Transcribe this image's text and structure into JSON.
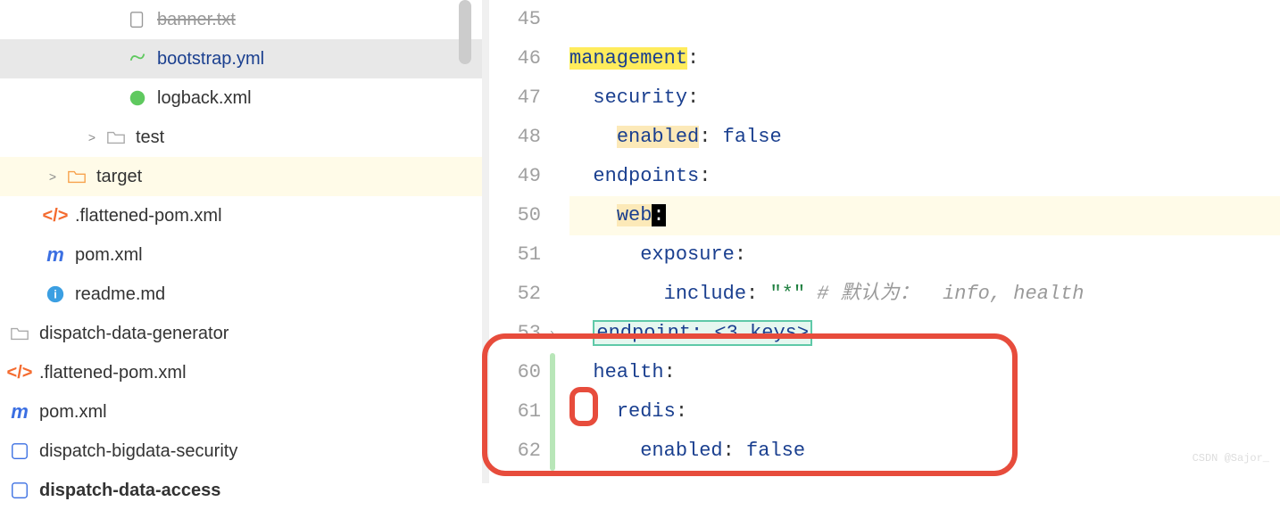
{
  "sidebar": {
    "items": [
      {
        "label": "banner.txt",
        "iconColor": "#888",
        "depth": 3,
        "selected": false,
        "bold": false,
        "expander": ""
      },
      {
        "label": "bootstrap.yml",
        "iconColor": "#5fc95f",
        "depth": 3,
        "selected": true,
        "bold": false,
        "expander": ""
      },
      {
        "label": "logback.xml",
        "iconColor": "#5fc95f",
        "depth": 3,
        "selected": false,
        "bold": false,
        "expander": ""
      },
      {
        "label": "test",
        "iconColor": "#bbb",
        "depth": 2,
        "selected": false,
        "bold": false,
        "expander": ">"
      },
      {
        "label": "target",
        "iconColor": "#f7a24c",
        "depth": 1,
        "selected": false,
        "bold": false,
        "expander": ">",
        "hl": true
      },
      {
        "label": ".flattened-pom.xml",
        "iconColor": "#f46b2f",
        "depth": 1,
        "selected": false,
        "bold": false,
        "expander": ""
      },
      {
        "label": "pom.xml",
        "iconColor": "#3b6fe2",
        "depth": 1,
        "selected": false,
        "bold": false,
        "expander": ""
      },
      {
        "label": "readme.md",
        "iconColor": "#3b9fe2",
        "depth": 1,
        "selected": false,
        "bold": false,
        "expander": ""
      },
      {
        "label": "dispatch-data-generator",
        "iconColor": "#bbb",
        "depth": 0,
        "selected": false,
        "bold": false,
        "expander": ""
      },
      {
        "label": ".flattened-pom.xml",
        "iconColor": "#f46b2f",
        "depth": 0,
        "selected": false,
        "bold": false,
        "expander": ""
      },
      {
        "label": "pom.xml",
        "iconColor": "#3b6fe2",
        "depth": 0,
        "selected": false,
        "bold": false,
        "expander": ""
      },
      {
        "label": "dispatch-bigdata-security",
        "iconColor": "#3b6fe2",
        "depth": 0,
        "selected": false,
        "bold": false,
        "expander": ""
      },
      {
        "label": "dispatch-data-access",
        "iconColor": "#3b6fe2",
        "depth": 0,
        "selected": false,
        "bold": true,
        "expander": ""
      }
    ]
  },
  "editor": {
    "lines": [
      45,
      46,
      47,
      48,
      49,
      50,
      51,
      52,
      53,
      60,
      61,
      62
    ],
    "code": {
      "management": "management",
      "security": "security",
      "enabled": "enabled",
      "false": "false",
      "endpoints": "endpoints",
      "web": "web",
      "exposure": "exposure",
      "include": "include",
      "star": "\"*\"",
      "comment1": "# 默认为：",
      "comment2": "info, health",
      "endpoint_fold": "endpoint: <3 keys>",
      "health": "health",
      "redis": "redis",
      "colon": ":"
    }
  },
  "watermark": "CSDN @Sajor_"
}
